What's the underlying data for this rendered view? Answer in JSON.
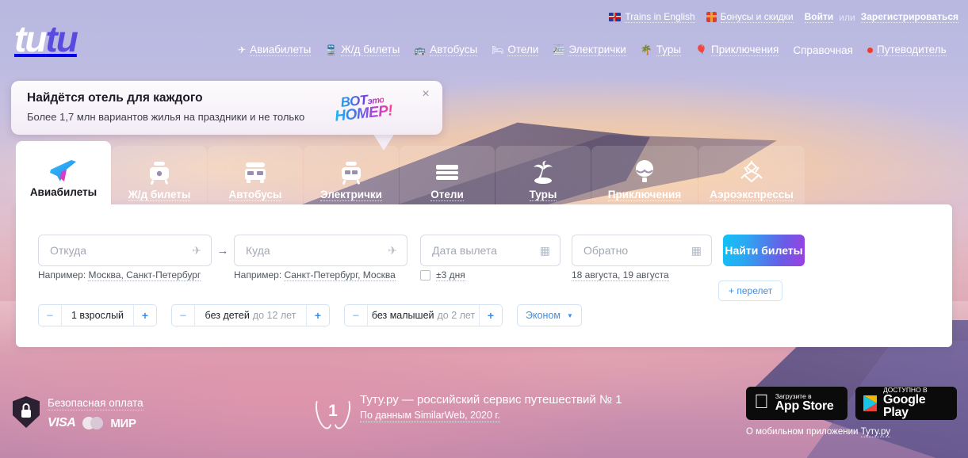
{
  "topbar": {
    "trains_en": "Trains in English",
    "bonuses": "Бонусы и скидки",
    "login": "Войти",
    "or": "или",
    "register": "Зарегистрироваться"
  },
  "logo": {
    "part1": "tu",
    "part2": "tu"
  },
  "nav": {
    "items": [
      {
        "label": "Авиабилеты",
        "icon": "plane-icon"
      },
      {
        "label": "Ж/д билеты",
        "icon": "train-icon"
      },
      {
        "label": "Автобусы",
        "icon": "bus-icon"
      },
      {
        "label": "Отели",
        "icon": "bed-icon"
      },
      {
        "label": "Электрички",
        "icon": "commuter-train-icon"
      },
      {
        "label": "Туры",
        "icon": "palm-icon"
      },
      {
        "label": "Приключения",
        "icon": "balloon-icon"
      },
      {
        "label": "Справочная",
        "icon": "none"
      },
      {
        "label": "Путеводитель",
        "icon": "red-dot-icon"
      }
    ]
  },
  "promo": {
    "title": "Найдётся отель для каждого",
    "subtitle": "Более 1,7 млн вариантов жилья на праздники и не только",
    "badge_line1": "ВОТ",
    "badge_line1_small": "это",
    "badge_line2": "НОМЕР!",
    "close": "×"
  },
  "tabs": [
    {
      "label": "Авиабилеты",
      "icon": "plane-icon",
      "active": true
    },
    {
      "label": "Ж/д билеты",
      "icon": "train-icon",
      "active": false
    },
    {
      "label": "Автобусы",
      "icon": "bus-icon",
      "active": false
    },
    {
      "label": "Электрички",
      "icon": "commuter-train-icon",
      "active": false
    },
    {
      "label": "Отели",
      "icon": "bed-icon",
      "active": false
    },
    {
      "label": "Туры",
      "icon": "palm-icon",
      "active": false
    },
    {
      "label": "Приключения",
      "icon": "balloon-icon",
      "active": false
    },
    {
      "label": "Аэроэкспрессы",
      "icon": "aeroexpress-icon",
      "active": false
    }
  ],
  "search": {
    "from_placeholder": "Откуда",
    "from_value": "",
    "from_hint_prefix": "Например: ",
    "from_hint_link": "Москва, Санкт-Петербург",
    "to_placeholder": "Куда",
    "to_value": "",
    "to_hint_prefix": "Например: ",
    "to_hint_link": "Санкт-Петербург, Москва",
    "depart_placeholder": "Дата вылета",
    "depart_value": "",
    "return_placeholder": "Обратно",
    "return_value": "",
    "flex_days_label": "±3 дня",
    "flex_days_checked": false,
    "date_hint": "18 августа, 19 августа",
    "submit_label": "Найти билеты",
    "add_flight_label": "+ перелет",
    "arrow": "→"
  },
  "passengers": {
    "adults": {
      "value": "1 взрослый",
      "minus": "−",
      "plus": "+"
    },
    "children": {
      "value": "без детей",
      "suffix": "до 12 лет",
      "minus": "−",
      "plus": "+"
    },
    "infants": {
      "value": "без малышей",
      "suffix": "до 2 лет",
      "minus": "−",
      "plus": "+"
    },
    "cabin_class": "Эконом",
    "cabin_caret": "▼"
  },
  "footer": {
    "secure_payment": "Безопасная оплата",
    "cards": {
      "visa": "VISA",
      "mir": "МИР"
    },
    "award_number": "1",
    "award_title": "Туту.ру — российский сервис путешествий № 1",
    "award_source": "По данным SimilarWeb, 2020 г.",
    "app_store": {
      "top": "Загрузите в",
      "bottom": "App Store"
    },
    "google_play": {
      "top": "ДОСТУПНО В",
      "bottom": "Google Play"
    },
    "app_note_prefix": "О мобильном приложении ",
    "app_note_link": "Туту.ру"
  },
  "colors": {
    "accent_blue": "#3b8fe8",
    "logo_violet": "#5a4be0",
    "red_dot": "#e8402a",
    "button_gradient_start": "#13c2f5",
    "button_gradient_end": "#9b3fe0"
  }
}
